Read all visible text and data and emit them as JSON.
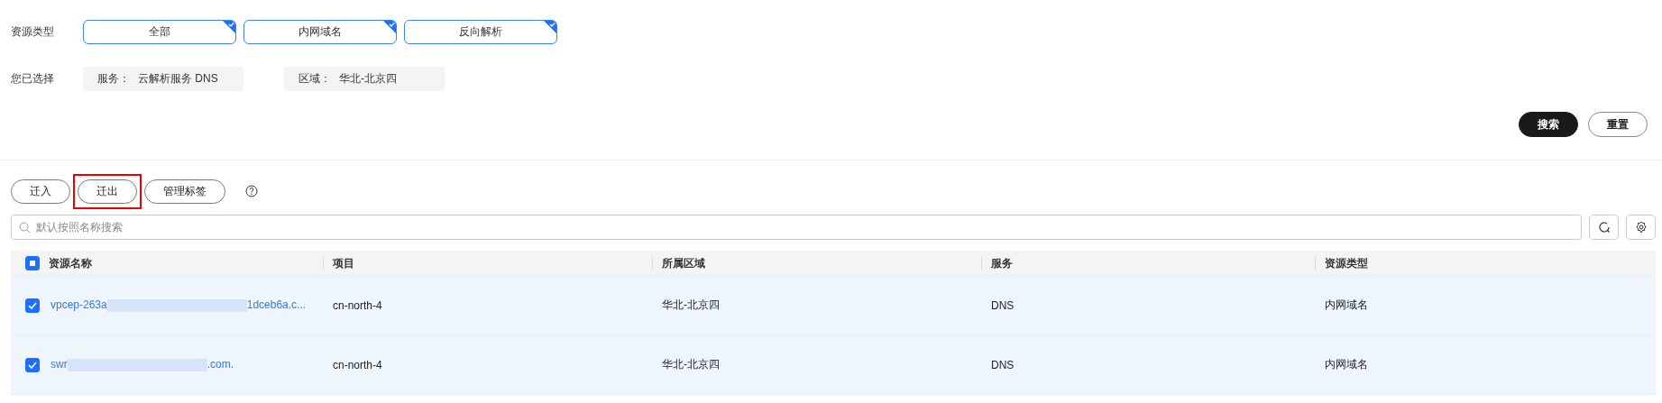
{
  "filters": {
    "resource_type": {
      "label": "资源类型",
      "options": [
        {
          "label": "全部",
          "selected": true
        },
        {
          "label": "内网域名",
          "selected": true
        },
        {
          "label": "反向解析",
          "selected": true
        }
      ]
    },
    "selected": {
      "label": "您已选择",
      "items": [
        {
          "key": "服务：",
          "value": "云解析服务 DNS"
        },
        {
          "key": "区域：",
          "value": "华北-北京四"
        }
      ]
    },
    "buttons": [
      {
        "label": "搜索",
        "kind": "primary"
      },
      {
        "label": "重置",
        "kind": "secondary"
      }
    ]
  },
  "toolbar": {
    "buttons": [
      {
        "label": "迁入",
        "highlighted": false
      },
      {
        "label": "迁出",
        "highlighted": true
      },
      {
        "label": "管理标签",
        "highlighted": false
      }
    ]
  },
  "search": {
    "placeholder": "默认按照名称搜索"
  },
  "table": {
    "select_all_partial": true,
    "columns": [
      "资源名称",
      "项目",
      "所属区域",
      "服务",
      "资源类型"
    ],
    "rows": [
      {
        "selected": true,
        "name_parts": [
          "vpcep-263a",
          "1dceb6a.c..."
        ],
        "project": "cn-north-4",
        "region": "华北-北京四",
        "service": "DNS",
        "type": "内网域名"
      },
      {
        "selected": true,
        "name_parts": [
          "swr",
          ".com."
        ],
        "project": "cn-north-4",
        "region": "华北-北京四",
        "service": "DNS",
        "type": "内网域名"
      }
    ]
  }
}
